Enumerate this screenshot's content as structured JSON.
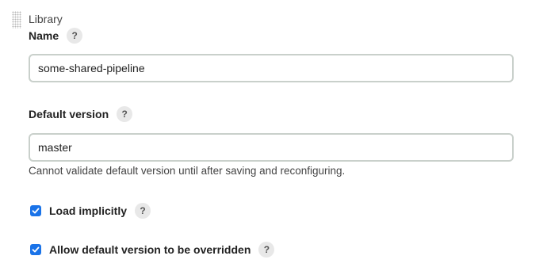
{
  "section": {
    "title": "Library",
    "drag_icon": "drag-handle-icon"
  },
  "name_field": {
    "label": "Name",
    "help": "?",
    "value": "some-shared-pipeline"
  },
  "default_version_field": {
    "label": "Default version",
    "help": "?",
    "value": "master",
    "hint": "Cannot validate default version until after saving and reconfiguring."
  },
  "load_implicitly": {
    "label": "Load implicitly",
    "checked": true,
    "help": "?"
  },
  "allow_override": {
    "label": "Allow default version to be overridden",
    "checked": true,
    "help": "?"
  },
  "colors": {
    "checkbox": "#1a73e8",
    "input_border": "#c9d0cb",
    "help_bg": "#e8e8e8"
  }
}
